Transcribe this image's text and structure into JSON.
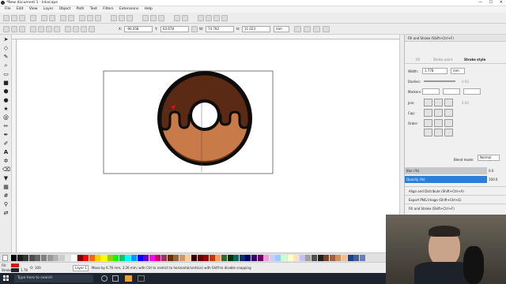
{
  "window": {
    "title": "*New document 1 - Inkscape",
    "controls": [
      "—",
      "☐",
      "✕"
    ]
  },
  "menu": [
    "File",
    "Edit",
    "View",
    "Layer",
    "Object",
    "Path",
    "Text",
    "Filters",
    "Extensions",
    "Help"
  ],
  "controls_bar": {
    "x_label": "X:",
    "x_value": "-90.458",
    "y_label": "Y:",
    "y_value": "63.678",
    "w_label": "W:",
    "w_value": "74.792",
    "h_label": "H:",
    "h_value": "11.023",
    "unit": "mm"
  },
  "panel": {
    "title": "Fill and Stroke (Shift+Ctrl+F)",
    "tabs": [
      "Fill",
      "Stroke paint",
      "Stroke style"
    ],
    "width_label": "Width:",
    "width_value": "1.778",
    "width_unit": "mm",
    "dashes_label": "Dashes:",
    "dashes_value": "0.00",
    "markers_label": "Markers:",
    "join_label": "Join:",
    "join_value": "4.00",
    "cap_label": "Cap:",
    "order_label": "Order:",
    "blend_label": "Blend mode:",
    "blend_value": "Normal",
    "blur_label": "Blur (%)",
    "blur_value": "0.0",
    "opacity_label": "Opacity (%)",
    "opacity_value": "100.0",
    "docked": [
      "Align and Distribute (Shift+Ctrl+A)",
      "Export PNG Image (Shift+Ctrl+E)",
      "Fill and Stroke (Shift+Ctrl+F)"
    ]
  },
  "status": {
    "fill_label": "Fill:",
    "stroke_label": "Stroke:",
    "stroke_value": "1.78",
    "opacity_label": "O:",
    "opacity_value": "100",
    "layer": "Layer 1",
    "message": "Move by 6.76 mm, 3.26 mm; with Ctrl to restrict to horizontal/vertical; with Shift to disable snapping"
  },
  "taskbar": {
    "search_placeholder": "Type here to search"
  },
  "colors": {
    "donut_base": "#c87a48",
    "donut_shadow": "#6b3212",
    "icing": "#5a2a14",
    "outline": "#0f0d0c",
    "panel_accent": "#2b7fd6",
    "red_fill": "#e01010"
  },
  "palette": [
    "#000000",
    "#1a1a1a",
    "#333333",
    "#4d4d4d",
    "#666666",
    "#808080",
    "#999999",
    "#b3b3b3",
    "#cccccc",
    "#e6e6e6",
    "#ffffff",
    "#800000",
    "#ff0000",
    "#ff6600",
    "#ffcc00",
    "#ffff00",
    "#99cc00",
    "#00ff00",
    "#00cc66",
    "#00ffff",
    "#0099ff",
    "#0000ff",
    "#6600cc",
    "#ff00ff",
    "#cc0066",
    "#993366",
    "#663300",
    "#996633",
    "#cc9966",
    "#ffcc99",
    "#330000",
    "#660000",
    "#990000",
    "#cc3300",
    "#ff9966",
    "#336633",
    "#003300",
    "#006666",
    "#003366",
    "#000066",
    "#330066",
    "#660066",
    "#ff99cc",
    "#ccccff",
    "#99ccff",
    "#ccffcc",
    "#ffffcc",
    "#ffe0c0",
    "#c0c0ff",
    "#a0a0a0",
    "#505050",
    "#202020",
    "#804020",
    "#a06040",
    "#d09060",
    "#f0c090",
    "#204080",
    "#4060a0",
    "#6080c0"
  ]
}
